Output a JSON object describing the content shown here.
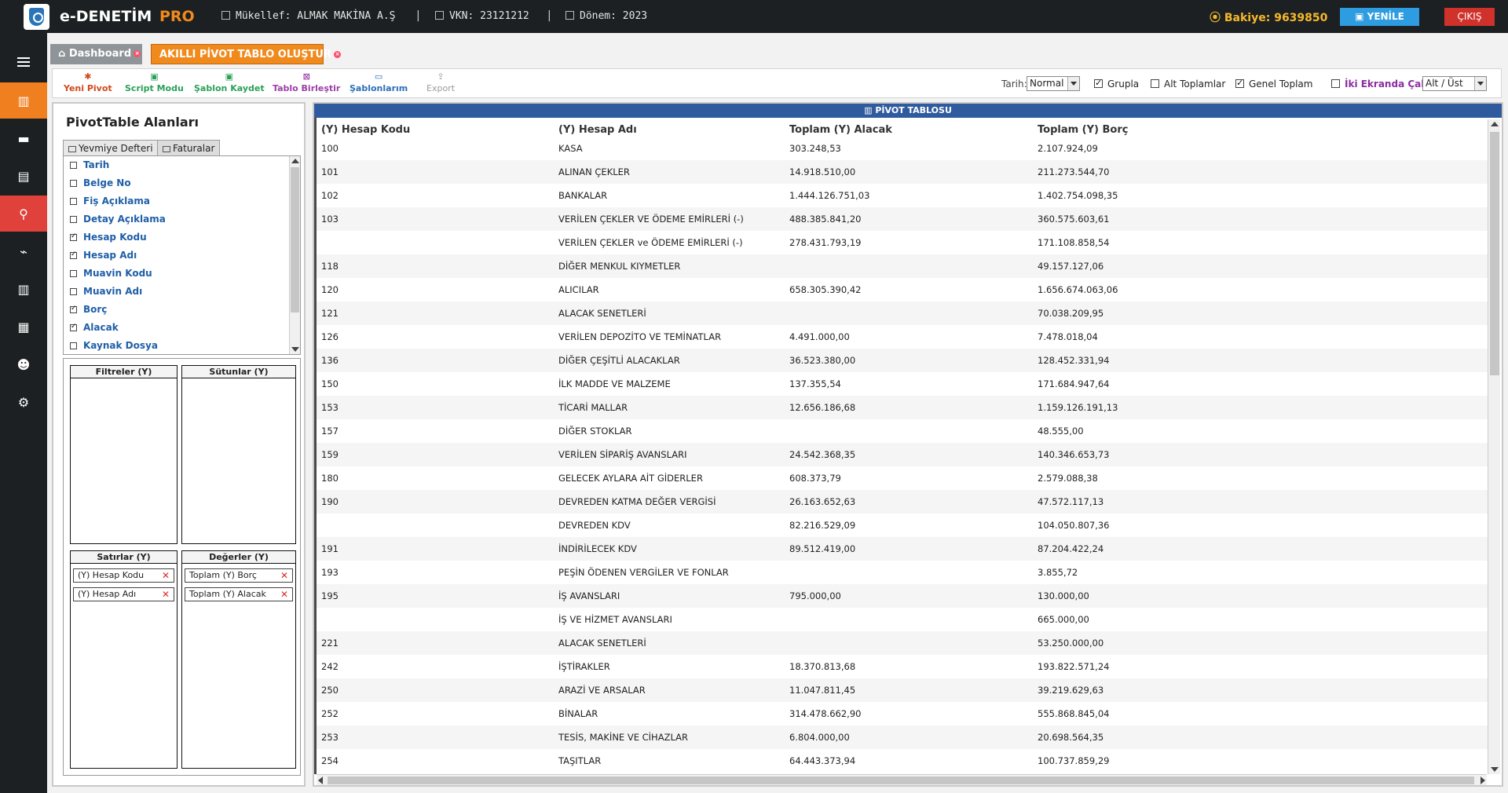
{
  "header": {
    "brand": "e-DENETİM",
    "brand_suffix": "PRO",
    "taxpayer": "Mükellef: ALMAK MAKİNA A.Ş",
    "vkn": "VKN: 23121212",
    "period": "Dönem: 2023",
    "balance": "Bakiye: 9639850",
    "refresh_label": "YENİLE",
    "logout_label": "ÇIKIŞ",
    "accent_color": "#f08a1d"
  },
  "nav": {
    "icons": [
      "menu-icon",
      "dashboard-icon",
      "briefcase-icon",
      "document-icon",
      "search-icon",
      "chart-icon",
      "table-icon",
      "files-icon",
      "users-icon",
      "settings-icon"
    ]
  },
  "tabs": [
    {
      "label": "Dashboard",
      "active": false
    },
    {
      "label": "AKILLI PİVOT TABLO OLUŞTUR",
      "active": true
    }
  ],
  "toolbar": {
    "new_pivot": "Yeni Pivot",
    "script_mode": "Script Modu",
    "save_template": "Şablon Kaydet",
    "merge_tables": "Tablo Birleştir",
    "my_templates": "Şablonlarım",
    "export": "Export",
    "date_label": "Tarih:",
    "date_value": "Normal",
    "group_label": "Grupla",
    "group_checked": true,
    "subtotals_label": "Alt Toplamlar",
    "subtotals_checked": false,
    "grand_total_label": "Genel Toplam",
    "grand_total_checked": true,
    "dual_screen_label": "İki Ekranda Çalış",
    "dual_screen_checked": false,
    "layout_value": "Alt / Üst"
  },
  "fields": {
    "title": "PivotTable Alanları",
    "sources": [
      "Yevmiye Defteri",
      "Faturalar"
    ],
    "items": [
      {
        "label": "Tarih",
        "checked": false
      },
      {
        "label": "Belge No",
        "checked": false
      },
      {
        "label": "Fiş Açıklama",
        "checked": false
      },
      {
        "label": "Detay Açıklama",
        "checked": false
      },
      {
        "label": "Hesap Kodu",
        "checked": true
      },
      {
        "label": "Hesap Adı",
        "checked": true
      },
      {
        "label": "Muavin Kodu",
        "checked": false
      },
      {
        "label": "Muavin Adı",
        "checked": false
      },
      {
        "label": "Borç",
        "checked": true
      },
      {
        "label": "Alacak",
        "checked": true
      },
      {
        "label": "Kaynak Dosya",
        "checked": false
      }
    ],
    "zones": {
      "filters": "Filtreler (Y)",
      "columns": "Sütunlar (Y)",
      "rows": "Satırlar (Y)",
      "values": "Değerler (Y)",
      "row_items": [
        "(Y) Hesap Kodu",
        "(Y) Hesap Adı"
      ],
      "value_items": [
        "Toplam (Y) Borç",
        "Toplam (Y) Alacak"
      ]
    }
  },
  "pivot": {
    "title": "PİVOT TABLOSU",
    "columns": [
      "(Y) Hesap Kodu",
      "(Y) Hesap Adı",
      "Toplam (Y) Alacak",
      "Toplam (Y) Borç"
    ],
    "rows": [
      [
        "100",
        "KASA",
        "303.248,53",
        "2.107.924,09"
      ],
      [
        "101",
        "ALINAN ÇEKLER",
        "14.918.510,00",
        "211.273.544,70"
      ],
      [
        "102",
        "BANKALAR",
        "1.444.126.751,03",
        "1.402.754.098,35"
      ],
      [
        "103",
        "VERİLEN ÇEKLER VE ÖDEME EMİRLERİ (-)",
        "488.385.841,20",
        "360.575.603,61"
      ],
      [
        "",
        "VERİLEN ÇEKLER ve ÖDEME EMİRLERİ  (-)",
        "278.431.793,19",
        "171.108.858,54"
      ],
      [
        "118",
        "DİĞER MENKUL KIYMETLER",
        "",
        "49.157.127,06"
      ],
      [
        "120",
        "ALICILAR",
        "658.305.390,42",
        "1.656.674.063,06"
      ],
      [
        "121",
        "ALACAK SENETLERİ",
        "",
        "70.038.209,95"
      ],
      [
        "126",
        "VERİLEN DEPOZİTO VE TEMİNATLAR",
        "4.491.000,00",
        "7.478.018,04"
      ],
      [
        "136",
        "DİĞER ÇEŞİTLİ ALACAKLAR",
        "36.523.380,00",
        "128.452.331,94"
      ],
      [
        "150",
        "İLK MADDE VE MALZEME",
        "137.355,54",
        "171.684.947,64"
      ],
      [
        "153",
        "TİCARİ MALLAR",
        "12.656.186,68",
        "1.159.126.191,13"
      ],
      [
        "157",
        "DİĞER STOKLAR",
        "",
        "48.555,00"
      ],
      [
        "159",
        "VERİLEN SİPARİŞ AVANSLARI",
        "24.542.368,35",
        "140.346.653,73"
      ],
      [
        "180",
        "GELECEK AYLARA AİT GİDERLER",
        "608.373,79",
        "2.579.088,38"
      ],
      [
        "190",
        "DEVREDEN KATMA DEĞER VERGİSİ",
        "26.163.652,63",
        "47.572.117,13"
      ],
      [
        "",
        "DEVREDEN KDV",
        "82.216.529,09",
        "104.050.807,36"
      ],
      [
        "191",
        "İNDİRİLECEK KDV",
        "89.512.419,00",
        "87.204.422,24"
      ],
      [
        "193",
        "PEŞİN ÖDENEN VERGİLER VE FONLAR",
        "",
        "3.855,72"
      ],
      [
        "195",
        "İŞ AVANSLARI",
        "795.000,00",
        "130.000,00"
      ],
      [
        "",
        "İŞ VE HİZMET AVANSLARI",
        "",
        "665.000,00"
      ],
      [
        "221",
        "ALACAK SENETLERİ",
        "",
        "53.250.000,00"
      ],
      [
        "242",
        "İŞTİRAKLER",
        "18.370.813,68",
        "193.822.571,24"
      ],
      [
        "250",
        "ARAZİ VE ARSALAR",
        "11.047.811,45",
        "39.219.629,63"
      ],
      [
        "252",
        "BİNALAR",
        "314.478.662,90",
        "555.868.845,04"
      ],
      [
        "253",
        "TESİS, MAKİNE VE CİHAZLAR",
        "6.804.000,00",
        "20.698.564,35"
      ],
      [
        "254",
        "TAŞITLAR",
        "64.443.373,94",
        "100.737.859,29"
      ]
    ]
  }
}
